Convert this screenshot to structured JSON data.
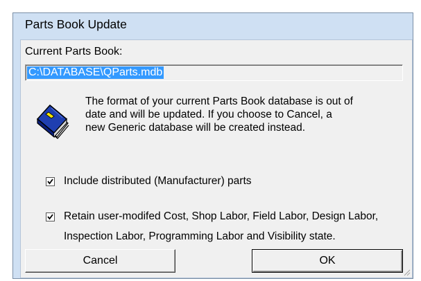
{
  "window": {
    "title": "Parts Book Update"
  },
  "dialog": {
    "current_label": "Current Parts Book:",
    "current_path": "C:\\DATABASE\\QParts.mdb",
    "message": "The format of your current Parts Book database is out of\ndate and will be updated.  If you choose to Cancel, a\nnew Generic database will be created instead.",
    "icon": "book-icon"
  },
  "options": {
    "include_distributed": {
      "label": "Include distributed (Manufacturer) parts",
      "checked": true
    },
    "retain_user_modified": {
      "label": "Retain user-modifed Cost, Shop Labor, Field Labor, Design Labor, Inspection Labor, Programming Labor and Visibility state.",
      "checked": true
    }
  },
  "buttons": {
    "cancel_label": "Cancel",
    "ok_label": "OK"
  },
  "colors": {
    "titlebar": "#cfe0f3",
    "client": "#f0f0f0",
    "selection": "#3399ff",
    "book_cover": "#1f3fb0"
  }
}
